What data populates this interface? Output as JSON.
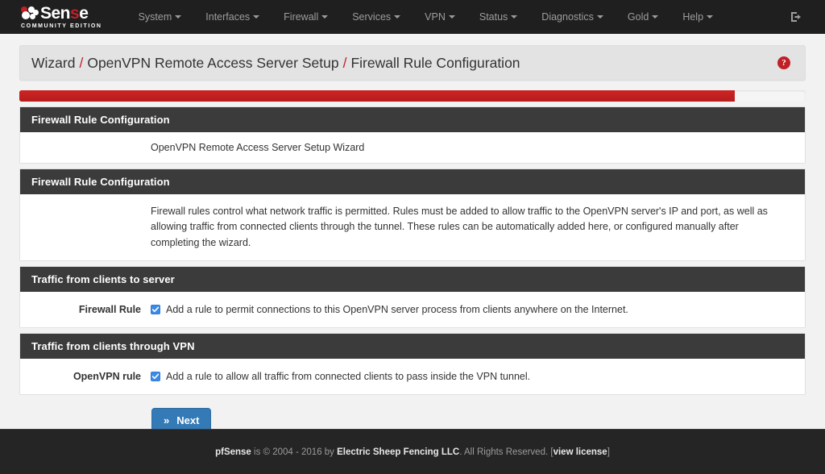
{
  "navbar": {
    "brand": {
      "prefix": "Sen",
      "accent": "s",
      "suffix": "e",
      "subtitle": "COMMUNITY EDITION"
    },
    "items": [
      {
        "label": "System"
      },
      {
        "label": "Interfaces"
      },
      {
        "label": "Firewall"
      },
      {
        "label": "Services"
      },
      {
        "label": "VPN"
      },
      {
        "label": "Status"
      },
      {
        "label": "Diagnostics"
      },
      {
        "label": "Gold"
      },
      {
        "label": "Help"
      }
    ],
    "logout_title": "Logout"
  },
  "breadcrumb": {
    "items": [
      "Wizard",
      "OpenVPN Remote Access Server Setup",
      "Firewall Rule Configuration"
    ],
    "separator": "/",
    "help_glyph": "?"
  },
  "progress": {
    "percent": 91,
    "color": "#c0201f"
  },
  "panels": [
    {
      "heading": "Firewall Rule Configuration",
      "note": "OpenVPN Remote Access Server Setup Wizard"
    },
    {
      "heading": "Firewall Rule Configuration",
      "description": "Firewall rules control what network traffic is permitted. Rules must be added to allow traffic to the OpenVPN server's IP and port, as well as allowing traffic from connected clients through the tunnel. These rules can be automatically added here, or configured manually after completing the wizard."
    },
    {
      "heading": "Traffic from clients to server",
      "field_label": "Firewall Rule",
      "checkbox_checked": true,
      "checkbox_text": "Add a rule to permit connections to this OpenVPN server process from clients anywhere on the Internet."
    },
    {
      "heading": "Traffic from clients through VPN",
      "field_label": "OpenVPN rule",
      "checkbox_checked": true,
      "checkbox_text": "Add a rule to allow all traffic from connected clients to pass inside the VPN tunnel."
    }
  ],
  "actions": {
    "next_label": "Next",
    "next_icon": "»"
  },
  "footer": {
    "brand": "pfSense",
    "mid": " is © 2004 - 2016 by ",
    "company": "Electric Sheep Fencing LLC",
    "rights": ". All Rights Reserved. ",
    "bracket_open": "[",
    "license_link": "view license",
    "bracket_close": "]"
  }
}
